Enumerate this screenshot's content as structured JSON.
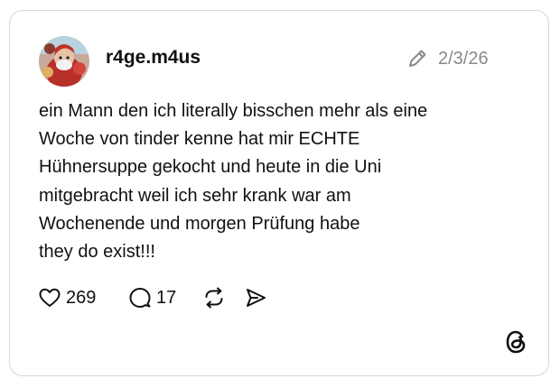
{
  "post": {
    "username": "r4ge.m4us",
    "date": "2/3/26",
    "lines": [
      "ein Mann den ich literally bisschen mehr als eine",
      "Woche von tinder kenne hat mir ECHTE",
      "Hühnersuppe gekocht und heute in die Uni",
      "mitgebracht weil ich sehr krank war am",
      "Wochenende und morgen Prüfung habe",
      "they do exist!!!"
    ]
  },
  "actions": {
    "likes": "269",
    "replies": "17"
  },
  "icons": {
    "edit": "pencil-icon",
    "like": "heart-icon",
    "reply": "comment-icon",
    "repost": "repost-icon",
    "share": "send-icon",
    "brand": "threads-logo-icon"
  },
  "colors": {
    "border": "#d7d7d7",
    "text": "#111111",
    "muted": "#8a8a8a"
  }
}
